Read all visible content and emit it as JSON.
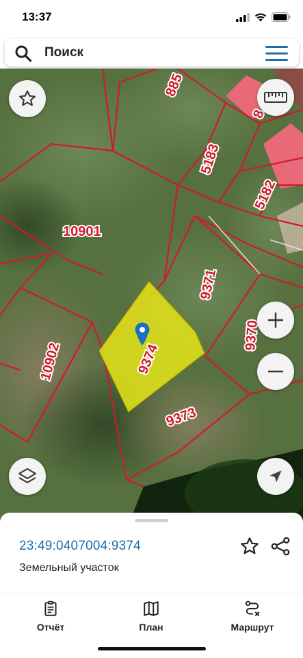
{
  "status_bar": {
    "time": "13:37"
  },
  "search": {
    "placeholder": "Поиск"
  },
  "map": {
    "parcels": [
      {
        "label": "10901"
      },
      {
        "label": "10902"
      },
      {
        "label": "9371"
      },
      {
        "label": "9374"
      },
      {
        "label": "9373"
      },
      {
        "label": "5183"
      },
      {
        "label": "5182"
      },
      {
        "label": "885"
      },
      {
        "label": "9370"
      },
      {
        "label": "8"
      }
    ],
    "selected_parcel_color": "#e5e51a",
    "boundary_color": "#d11a2a",
    "pin_color": "#1b6fc2"
  },
  "sheet": {
    "cadastral_number": "23:49:0407004:9374",
    "parcel_type": "Земельный участок"
  },
  "tabs": [
    {
      "label": "Отчёт",
      "icon": "report-icon"
    },
    {
      "label": "План",
      "icon": "map-icon"
    },
    {
      "label": "Маршрут",
      "icon": "route-icon"
    }
  ],
  "colors": {
    "accent": "#1e6ea8"
  }
}
